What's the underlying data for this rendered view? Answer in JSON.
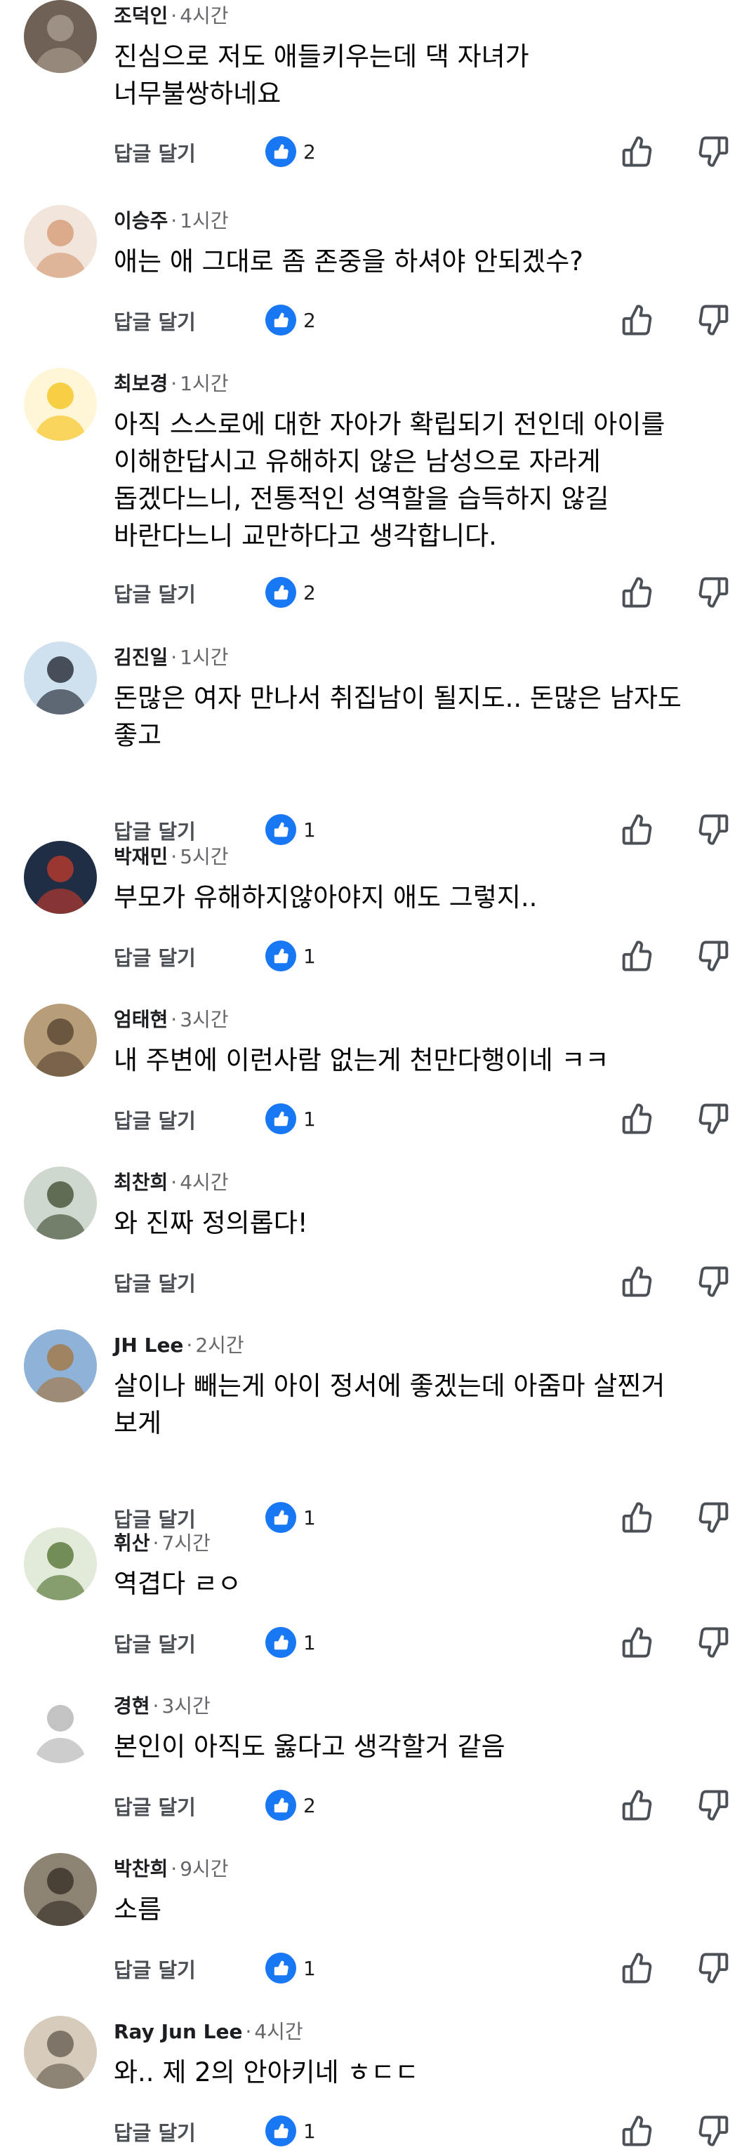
{
  "ui": {
    "reply_label": "답글 달기",
    "separator": "·",
    "accent": "#1877f2",
    "meta_color": "#65676b"
  },
  "comments": [
    {
      "author": "조덕인",
      "time": "4시간",
      "lines": [
        "진심으로 저도 애들키우는데 댁 자녀가",
        "너무불쌍하네요"
      ],
      "likes": "2",
      "avatar_icon": "brown-sign-photo-avatar",
      "avatar_colors": [
        "#6f6156",
        "#a6998c"
      ]
    },
    {
      "author": "이승주",
      "time": "1시간",
      "lines": [
        "애는 애 그대로 좀 존중을 하셔야 안되겠수?"
      ],
      "likes": "2",
      "avatar_icon": "couple-cartoon-avatar",
      "avatar_colors": [
        "#f2e6dc",
        "#d7a07c"
      ]
    },
    {
      "author": "최보경",
      "time": "1시간",
      "lines": [
        "아직 스스로에 대한 자아가 확립되기 전인데 아이를",
        "이해한답시고 유해하지 않은 남성으로 자라게",
        "돕겠다느니, 전통적인 성역할을 습득하지 않길",
        "바란다느니 교만하다고 생각합니다."
      ],
      "likes": "2",
      "avatar_icon": "yellow-chick-avatar",
      "avatar_colors": [
        "#fff6d8",
        "#f6c82a"
      ]
    },
    {
      "author": "김진일",
      "time": "1시간",
      "lines": [
        "돈많은 여자 만나서 취집남이 될지도.. 돈많은 남자도",
        "좋고"
      ],
      "likes": "1",
      "avatar_icon": "ski-goggles-avatar",
      "avatar_colors": [
        "#cfe0ee",
        "#2e3440"
      ]
    },
    {
      "author": "박재민",
      "time": "5시간",
      "lines": [
        "부모가 유해하지않아야지 애도 그렇지.."
      ],
      "likes": "1",
      "avatar_icon": "dark-photo-avatar",
      "avatar_colors": [
        "#1f2d45",
        "#b03a2e"
      ]
    },
    {
      "author": "엄태현",
      "time": "3시간",
      "lines": [
        "내 주변에 이런사람 없는게 천만다행이네 ㅋㅋ"
      ],
      "likes": "1",
      "avatar_icon": "rock-landscape-avatar",
      "avatar_colors": [
        "#b79d78",
        "#5e4a36"
      ]
    },
    {
      "author": "최찬희",
      "time": "4시간",
      "lines": [
        "와 진짜 정의롭다!"
      ],
      "likes": "",
      "avatar_icon": "group-photo-avatar",
      "avatar_colors": [
        "#cfd8cf",
        "#4b5a3f"
      ]
    },
    {
      "author": "JH Lee",
      "time": "2시간",
      "lines": [
        "살이나 빼는게 아이 정서에 좋겠는데 아줌마 살찐거",
        "보게"
      ],
      "likes": "1",
      "avatar_icon": "travel-photo-avatar",
      "avatar_colors": [
        "#8fb2d8",
        "#a37a4c"
      ]
    },
    {
      "author": "휘산",
      "time": "7시간",
      "lines": [
        "역겹다 ㄹㅇ"
      ],
      "likes": "1",
      "avatar_icon": "field-photo-avatar",
      "avatar_colors": [
        "#e2ead9",
        "#5f7d3e"
      ]
    },
    {
      "author": "경현",
      "time": "3시간",
      "lines": [
        "본인이 아직도 옳다고 생각할거 같음"
      ],
      "likes": "2",
      "avatar_icon": "giraffe-sketch-avatar",
      "avatar_colors": [
        "#ffffff",
        "#b8b8b8"
      ]
    },
    {
      "author": "박찬희",
      "time": "9시간",
      "lines": [
        "소름"
      ],
      "likes": "1",
      "avatar_icon": "animals-photo-avatar",
      "avatar_colors": [
        "#8c8373",
        "#3d352c"
      ]
    },
    {
      "author": "Ray Jun Lee",
      "time": "4시간",
      "lines": [
        "와.. 제 2의 안아키네 ㅎㄷㄷ"
      ],
      "likes": "1",
      "avatar_icon": "city-photo-avatar",
      "avatar_colors": [
        "#d7cbbb",
        "#6f6558"
      ]
    }
  ]
}
